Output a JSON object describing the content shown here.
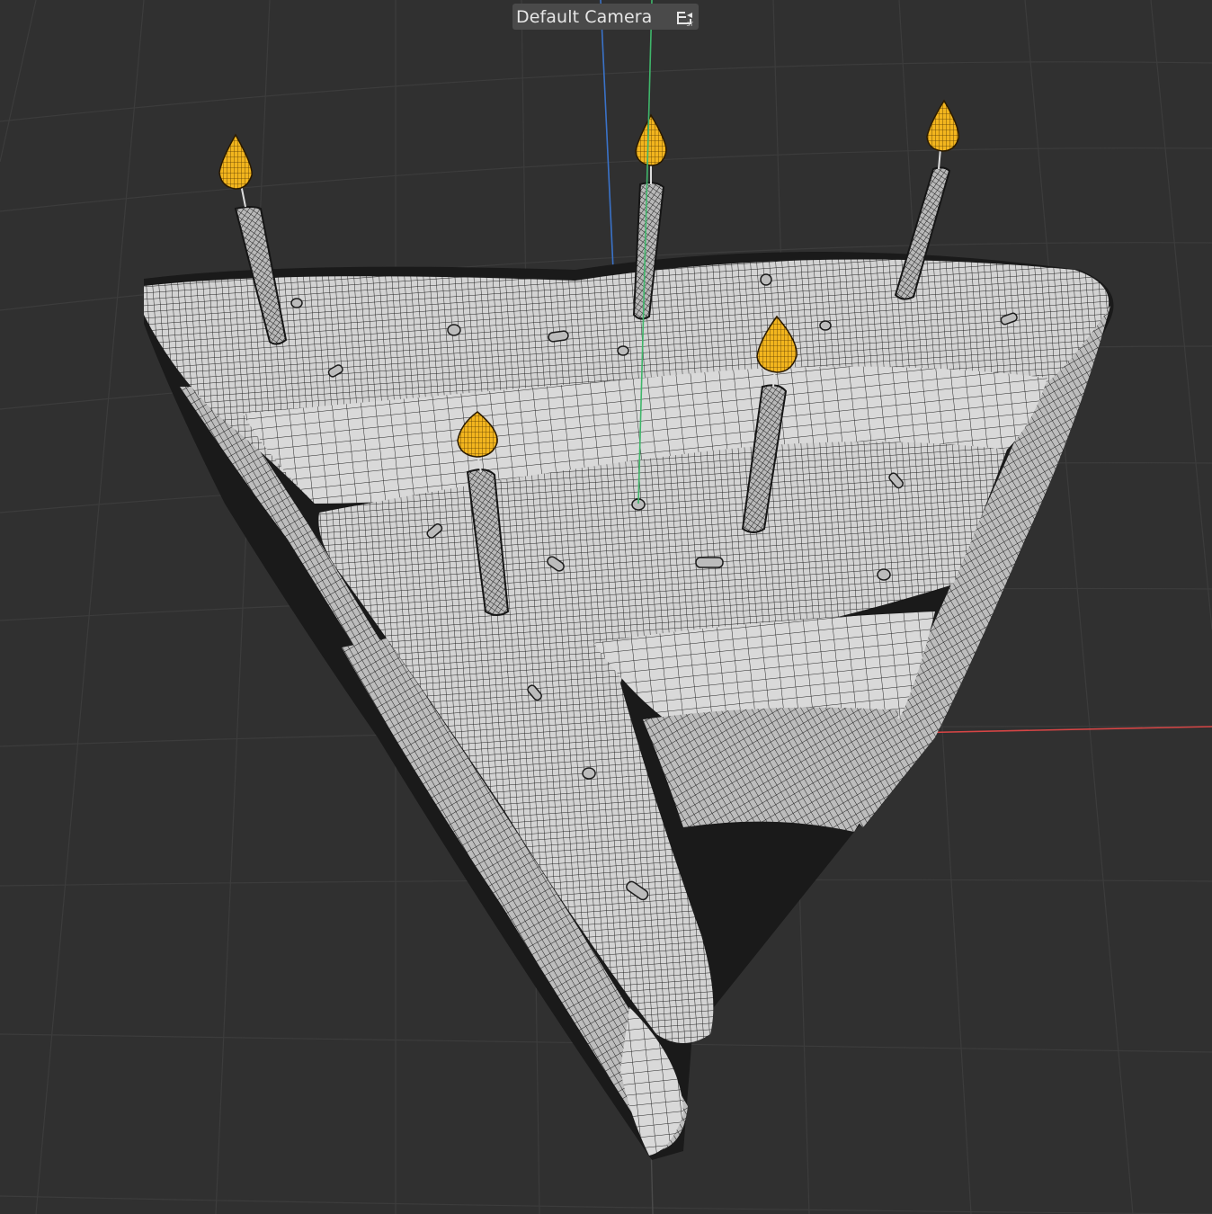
{
  "viewport": {
    "camera_label": "Default Camera",
    "camera_icon": "camera-switch-icon",
    "shading_mode": "wireframe-on-shaded",
    "colors": {
      "background": "#303030",
      "grid": "#3d3d3d",
      "axis_x": "#d64545",
      "axis_y": "#3fb56a",
      "axis_z": "#3a72c8",
      "mesh_fill": "#cfcfcf",
      "mesh_wire": "#1e1e1e",
      "flame": "#f0b429"
    }
  },
  "scene": {
    "object": "cake-slice",
    "candle_count": 5
  }
}
